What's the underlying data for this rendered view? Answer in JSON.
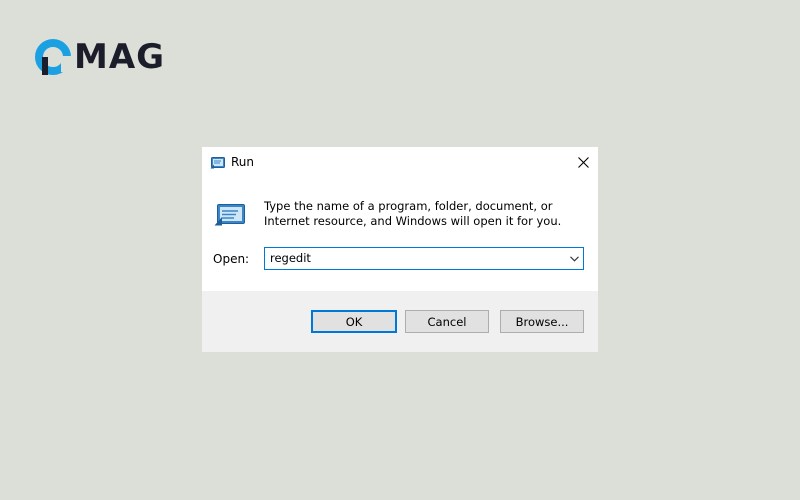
{
  "logo": {
    "text": "MAG"
  },
  "dialog": {
    "title": "Run",
    "description": "Type the name of a program, folder, document, or Internet resource, and Windows will open it for you.",
    "open_label": "Open:",
    "open_value": "regedit",
    "buttons": {
      "ok": "OK",
      "cancel": "Cancel",
      "browse": "Browse..."
    }
  },
  "colors": {
    "background": "#dcdfd7",
    "logo_accent": "#1ba1e2",
    "focus": "#0078d7"
  },
  "icons": {
    "title": "run-icon",
    "big": "run-icon",
    "close": "close-icon",
    "dropdown": "chevron-down-icon"
  }
}
